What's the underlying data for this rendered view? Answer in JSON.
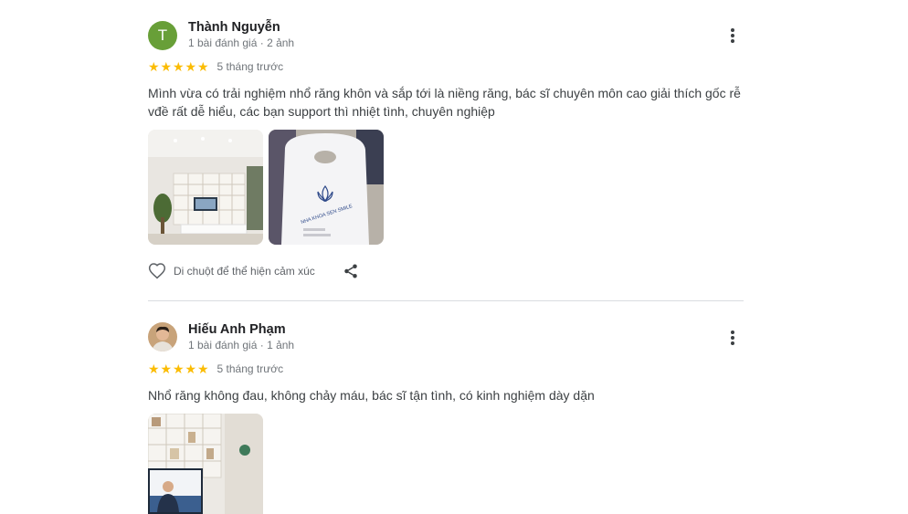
{
  "reviews": [
    {
      "author": "Thành Nguyễn",
      "avatar_letter": "T",
      "meta": "1 bài đánh giá · 2 ảnh",
      "rating": 5,
      "stars": "★★★★★",
      "time": "5 tháng trước",
      "text_line1": "Mình vừa có trải nghiệm nhổ răng khôn và sắp tới là niềng răng, bác sĩ chuyên môn cao giải thích gốc rễ",
      "text_line2": "vđề rất dễ hiểu, các bạn support thì nhiệt tình, chuyên nghiệp",
      "photo_bag_brand": "NHA KHOA SEN SMILE",
      "like_label": "Di chuột để thể hiện cảm xúc"
    },
    {
      "author": "Hiếu Anh Phạm",
      "meta": "1 bài đánh giá · 1 ảnh",
      "rating": 5,
      "stars": "★★★★★",
      "time": "5 tháng trước",
      "text": "Nhổ răng không đau, không chảy máu, bác sĩ tận tình, có kinh nghiệm dày dặn"
    }
  ],
  "icons": {
    "more": "more-vert-icon",
    "like": "heart-outline-icon",
    "share": "share-icon",
    "star": "star-icon"
  },
  "colors": {
    "star": "#fbbc04",
    "avatar_bg": "#689f38",
    "divider": "#dadce0"
  }
}
